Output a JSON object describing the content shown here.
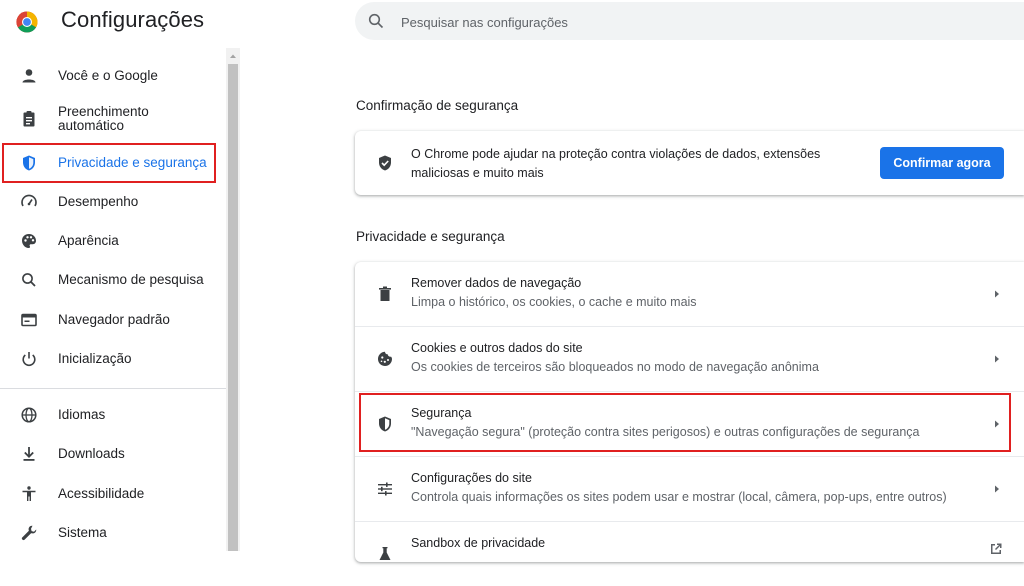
{
  "header": {
    "title": "Configurações",
    "search_placeholder": "Pesquisar nas configurações"
  },
  "sidebar": {
    "items": [
      {
        "label": "Você e o Google",
        "icon": "person-icon"
      },
      {
        "label": "Preenchimento automático",
        "icon": "clipboard-icon"
      },
      {
        "label": "Privacidade e segurança",
        "icon": "shield-icon",
        "active": true
      },
      {
        "label": "Desempenho",
        "icon": "speedometer-icon"
      },
      {
        "label": "Aparência",
        "icon": "palette-icon"
      },
      {
        "label": "Mecanismo de pesquisa",
        "icon": "search-icon"
      },
      {
        "label": "Navegador padrão",
        "icon": "browser-icon"
      },
      {
        "label": "Inicialização",
        "icon": "power-icon"
      },
      {
        "label": "Idiomas",
        "icon": "globe-icon"
      },
      {
        "label": "Downloads",
        "icon": "download-icon"
      },
      {
        "label": "Acessibilidade",
        "icon": "accessibility-icon"
      },
      {
        "label": "Sistema",
        "icon": "wrench-icon"
      }
    ]
  },
  "safety_check": {
    "section_title": "Confirmação de segurança",
    "text": "O Chrome pode ajudar na proteção contra violações de dados, extensões maliciosas e muito mais",
    "button_label": "Confirmar agora"
  },
  "privacy": {
    "section_title": "Privacidade e segurança",
    "rows": [
      {
        "title": "Remover dados de navegação",
        "subtitle": "Limpa o histórico, os cookies, o cache e muito mais",
        "icon": "trash-icon"
      },
      {
        "title": "Cookies e outros dados do site",
        "subtitle": "Os cookies de terceiros são bloqueados no modo de navegação anônima",
        "icon": "cookie-icon"
      },
      {
        "title": "Segurança",
        "subtitle": "\"Navegação segura\" (proteção contra sites perigosos) e outras configurações de segurança",
        "icon": "security-shield-icon"
      },
      {
        "title": "Configurações do site",
        "subtitle": "Controla quais informações os sites podem usar e mostrar (local, câmera, pop-ups, entre outros)",
        "icon": "sliders-icon"
      },
      {
        "title": "Sandbox de privacidade",
        "subtitle": "",
        "icon": "flask-icon"
      }
    ]
  },
  "colors": {
    "accent": "#1a73e8",
    "highlight": "#e02020"
  }
}
